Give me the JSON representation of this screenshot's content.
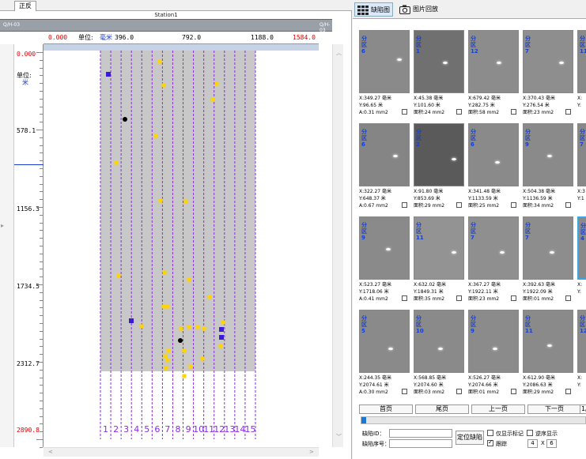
{
  "left_panel": {
    "tab_label": "正反",
    "station_label": "Station1",
    "header_left": "Q/H-03",
    "header_right": "Q/H-03",
    "scale": {
      "start": "0.000",
      "unit_label": "单位:",
      "unit": "毫米",
      "t1": "396.0",
      "t2": "792.0",
      "t3": "1188.0",
      "end": "1584.0"
    },
    "y_unit_label": "单位:",
    "y_unit": "米",
    "y_labels": [
      "0.000",
      "578.1",
      "1156.3",
      "1734.5",
      "2312.7",
      "2890.8"
    ],
    "lane_numbers": [
      "1",
      "2",
      "3",
      "4",
      "5",
      "6",
      "7",
      "8",
      "9",
      "10",
      "11",
      "12",
      "13",
      "14",
      "15"
    ]
  },
  "colors": {
    "strip": "#c8c8c8",
    "lane_line": "#8a2be2",
    "defect_yellow": "#ffd400",
    "defect_blue": "#3a1bd6",
    "defect_black": "#000000",
    "y_label_red": "#e00000",
    "unit_blue": "#1a3ad0",
    "progress": "#1a78d4"
  },
  "right_panel": {
    "toolbar": {
      "defect_map_label": "缺陷图",
      "image_review_label": "图片回放"
    },
    "thumbs": [
      {
        "zone": "分区6",
        "x": "X:349.27 毫米",
        "y": "Y:96.65 米",
        "area": "A:0.31 mm2",
        "checked": false,
        "tone": "#8a8a8a"
      },
      {
        "zone": "分区1",
        "x": "X:45.38 毫米",
        "y": "Y:101.60 米",
        "area": "面积:24 mm2",
        "checked": false,
        "tone": "#707070"
      },
      {
        "zone": "分区12",
        "x": "X:679.42 毫米",
        "y": "Y:282.75 米",
        "area": "面积:58 mm2",
        "checked": false,
        "tone": "#8c8c8c"
      },
      {
        "zone": "分区7",
        "x": "X:370.43 毫米",
        "y": "Y:276.54 米",
        "area": "面积:23 mm2",
        "checked": false,
        "tone": "#8e8e8e"
      },
      {
        "zone": "分区11",
        "x": "X:",
        "y": "Y:",
        "area": "",
        "checked": false,
        "tone": "#8a8a8a"
      },
      {
        "zone": "分区6",
        "x": "X:322.27 毫米",
        "y": "Y:648.37 米",
        "area": "A:0.67 mm2",
        "checked": false,
        "tone": "#858585"
      },
      {
        "zone": "分区2",
        "x": "X:91.80 毫米",
        "y": "Y:853.69 米",
        "area": "面积:29 mm2",
        "checked": false,
        "tone": "#5a5a5a"
      },
      {
        "zone": "分区6",
        "x": "X:341.48 毫米",
        "y": "Y:1133.59 米",
        "area": "面积:25 mm2",
        "checked": false,
        "tone": "#8a8a8a"
      },
      {
        "zone": "分区9",
        "x": "X:504.38 毫米",
        "y": "Y:1136.59 米",
        "area": "面积:34 mm2",
        "checked": false,
        "tone": "#8a8a8a"
      },
      {
        "zone": "分区7",
        "x": "X:3",
        "y": "Y:1",
        "area": "",
        "checked": false,
        "tone": "#888"
      },
      {
        "zone": "分区9",
        "x": "X:523.27 毫米",
        "y": "Y:1718.06 米",
        "area": "A:0.41 mm2",
        "checked": false,
        "tone": "#8a8a8a"
      },
      {
        "zone": "分区11",
        "x": "X:632.02 毫米",
        "y": "Y:1849.31 米",
        "area": "面积:35 mm2",
        "checked": false,
        "tone": "#939393"
      },
      {
        "zone": "分区7",
        "x": "X:367.27 毫米",
        "y": "Y:1922.11 米",
        "area": "面积:23 mm2",
        "checked": false,
        "tone": "#8f8f8f"
      },
      {
        "zone": "分区7",
        "x": "X:392.63 毫米",
        "y": "Y:1922.09 米",
        "area": "面积:01 mm2",
        "checked": false,
        "tone": "#8d8d8d"
      },
      {
        "zone": "分区4",
        "x": "X:",
        "y": "Y:",
        "area": "",
        "checked": false,
        "tone": "#8a8a8a",
        "selected": true
      },
      {
        "zone": "分区5",
        "x": "X:244.35 毫米",
        "y": "Y:2074.61 米",
        "area": "A:0.30 mm2",
        "checked": false,
        "tone": "#8a8a8a"
      },
      {
        "zone": "分区10",
        "x": "X:568.85 毫米",
        "y": "Y:2074.60 米",
        "area": "面积:03 mm2",
        "checked": false,
        "tone": "#8a8a8a"
      },
      {
        "zone": "分区9",
        "x": "X:526.27 毫米",
        "y": "Y:2074.66 米",
        "area": "面积:01 mm2",
        "checked": false,
        "tone": "#8b8b8b"
      },
      {
        "zone": "分区11",
        "x": "X:612.90 毫米",
        "y": "Y:2086.63 米",
        "area": "面积:29 mm2",
        "checked": false,
        "tone": "#8a8a8a"
      },
      {
        "zone": "分区12",
        "x": "X:",
        "y": "Y:",
        "area": "",
        "checked": false,
        "tone": "#8a8a8a"
      }
    ],
    "pager": {
      "first": "首页",
      "last": "尾页",
      "prev": "上一页",
      "next": "下一页",
      "page": "1/"
    },
    "progress": 0.02,
    "form": {
      "defect_id_label": "缺陷ID：",
      "defect_no_label": "缺陷序号：",
      "locate_button": "定位缺陷",
      "only_marked_label": "仅显示标记",
      "reverse_label": "逆序显示",
      "follow_label": "跟踪",
      "rows_value": "4",
      "x_sep": "X",
      "cols_value": "6"
    }
  }
}
